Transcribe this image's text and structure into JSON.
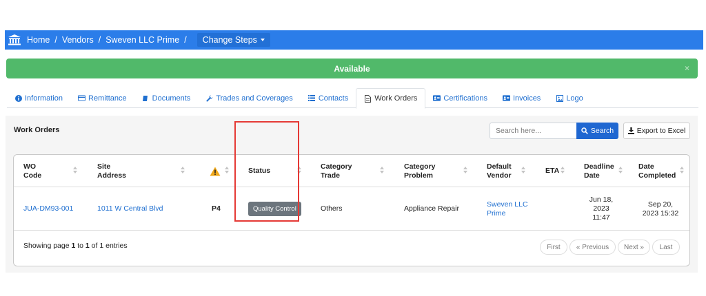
{
  "breadcrumb": {
    "icon": "bank-icon",
    "items": [
      "Home",
      "Vendors",
      "Sweven LLC Prime"
    ],
    "separator": "/",
    "change_steps": "Change Steps"
  },
  "alert": {
    "text": "Available",
    "close": "×",
    "color": "#51b96a"
  },
  "tabs": [
    {
      "label": "Information",
      "icon": "info-icon"
    },
    {
      "label": "Remittance",
      "icon": "credit-card-icon"
    },
    {
      "label": "Documents",
      "icon": "book-icon"
    },
    {
      "label": "Trades and Coverages",
      "icon": "wrench-icon"
    },
    {
      "label": "Contacts",
      "icon": "list-icon"
    },
    {
      "label": "Work Orders",
      "icon": "file-icon",
      "active": true
    },
    {
      "label": "Certifications",
      "icon": "id-card-icon"
    },
    {
      "label": "Invoices",
      "icon": "id-card-icon"
    },
    {
      "label": "Logo",
      "icon": "image-icon"
    }
  ],
  "panel": {
    "title": "Work Orders",
    "search_placeholder": "Search here...",
    "search_button": "Search",
    "export_button": "Export to Excel"
  },
  "table": {
    "headers": {
      "wo_code": [
        "WO",
        "Code"
      ],
      "site_address": [
        "Site",
        "Address"
      ],
      "priority": "warning-icon",
      "status": "Status",
      "category_trade": [
        "Category",
        "Trade"
      ],
      "category_problem": [
        "Category",
        "Problem"
      ],
      "default_vendor": [
        "Default",
        "Vendor"
      ],
      "eta": "ETA",
      "deadline_date": [
        "Deadline",
        "Date"
      ],
      "date_completed": [
        "Date",
        "Completed"
      ]
    },
    "rows": [
      {
        "wo_code": "JUA-DM93-001",
        "site_address": "1011 W Central Blvd",
        "priority": "P4",
        "status": "Quality Control",
        "category_trade": "Others",
        "category_problem": "Appliance Repair",
        "default_vendor": [
          "Sweven LLC",
          "Prime"
        ],
        "eta": "",
        "deadline_date": [
          "Jun 18,",
          "2023",
          "11:47"
        ],
        "date_completed": [
          "Sep 20,",
          "2023 15:32"
        ]
      }
    ]
  },
  "footer": {
    "showing_prefix": "Showing page ",
    "page": "1",
    "showing_mid": " to ",
    "total": "1",
    "showing_suffix": " of 1 entries",
    "pager": [
      "First",
      "« Previous",
      "Next »",
      "Last"
    ]
  },
  "colors": {
    "brand_blue": "#2b7de9",
    "link": "#1f6fd0",
    "highlight": "#e53935"
  }
}
